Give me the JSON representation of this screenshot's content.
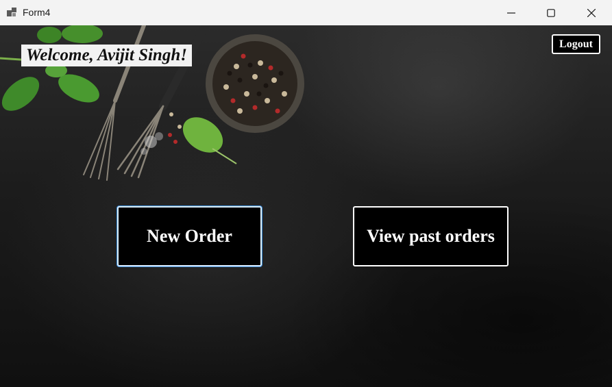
{
  "window": {
    "title": "Form4",
    "controls": [
      "minimize-icon",
      "maximize-icon",
      "close-icon"
    ]
  },
  "header": {
    "welcome_text": "Welcome, Avijit Singh!",
    "logout_label": "Logout"
  },
  "main": {
    "new_order_label": "New Order",
    "view_past_orders_label": "View past orders"
  },
  "colors": {
    "titlebar_bg": "#f3f3f3",
    "button_bg": "#000000",
    "button_border": "#ffffff",
    "focus_border": "#3a8ad8"
  }
}
